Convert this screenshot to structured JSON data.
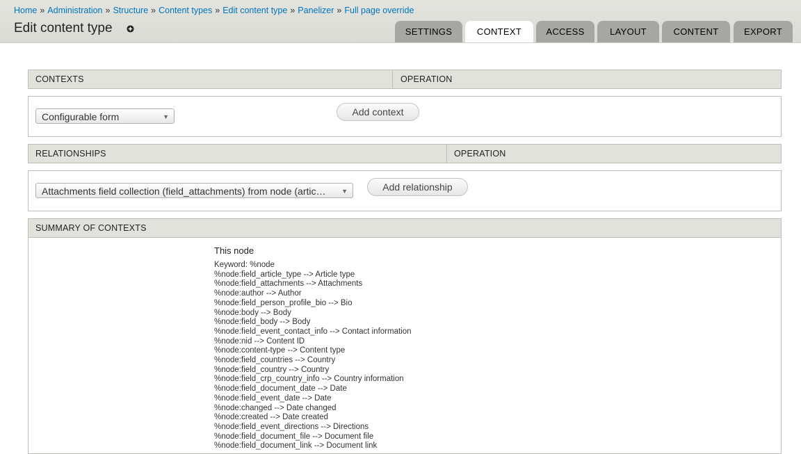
{
  "breadcrumb": [
    "Home",
    "Administration",
    "Structure",
    "Content types",
    "Edit content type",
    "Panelizer",
    "Full page override"
  ],
  "breadcrumb_separator": "»",
  "page_title": "Edit content type",
  "tabs": [
    {
      "label": "SETTINGS",
      "active": false
    },
    {
      "label": "CONTEXT",
      "active": true
    },
    {
      "label": "ACCESS",
      "active": false
    },
    {
      "label": "LAYOUT",
      "active": false
    },
    {
      "label": "CONTENT",
      "active": false
    },
    {
      "label": "EXPORT",
      "active": false
    }
  ],
  "contexts": {
    "header": "CONTEXTS",
    "operation": "OPERATION",
    "select_value": "Configurable form",
    "add_button": "Add context"
  },
  "relationships": {
    "header": "RELATIONSHIPS",
    "operation": "OPERATION",
    "select_value": "Attachments field collection (field_attachments) from node (artic…",
    "add_button": "Add relationship"
  },
  "summary": {
    "header": "SUMMARY OF CONTEXTS",
    "node_title": "This node",
    "keywords": [
      "Keyword: %node",
      "%node:field_article_type --> Article type",
      "%node:field_attachments --> Attachments",
      "%node:author --> Author",
      "%node:field_person_profile_bio --> Bio",
      "%node:body --> Body",
      "%node:field_body --> Body",
      "%node:field_event_contact_info --> Contact information",
      "%node:nid --> Content ID",
      "%node:content-type --> Content type",
      "%node:field_countries --> Country",
      "%node:field_country --> Country",
      "%node:field_crp_country_info --> Country information",
      "%node:field_document_date --> Date",
      "%node:field_event_date --> Date",
      "%node:changed --> Date changed",
      "%node:created --> Date created",
      "%node:field_event_directions --> Directions",
      "%node:field_document_file --> Document file",
      "%node:field_document_link --> Document link"
    ]
  },
  "colors": {
    "link": "#0074bd",
    "tab_inactive": "#a6a7a2",
    "header_bg": "#e1e2dc"
  }
}
